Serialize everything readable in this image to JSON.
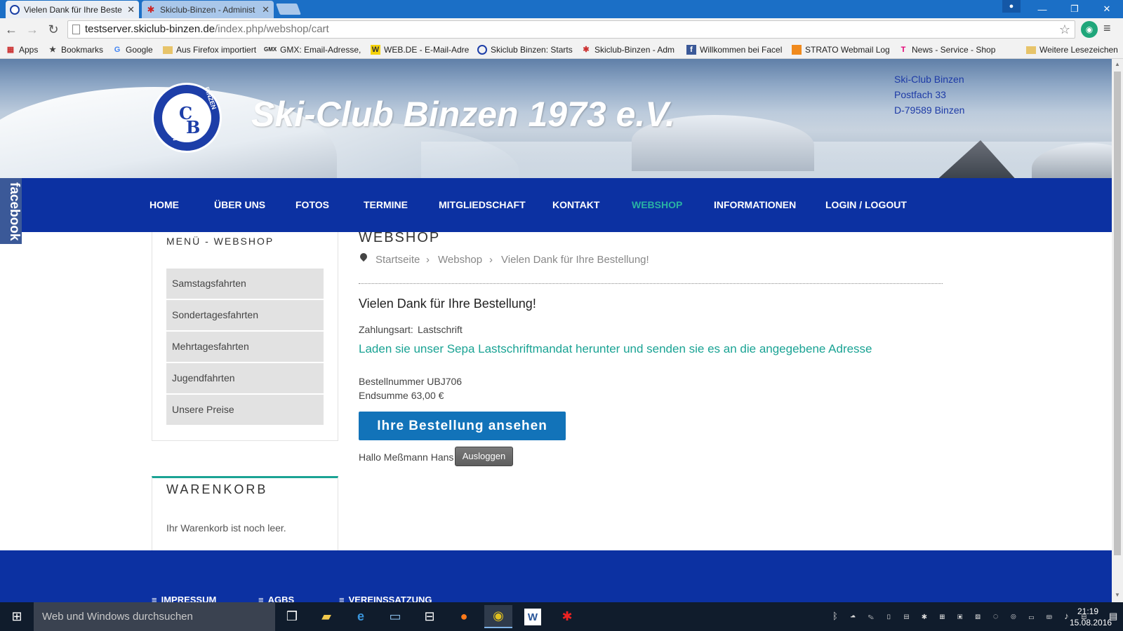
{
  "browser": {
    "tabs": [
      {
        "title": "Vielen Dank für Ihre Beste",
        "active": true
      },
      {
        "title": "Skiclub-Binzen - Administ",
        "active": false
      }
    ],
    "address": {
      "host": "testserver.skiclub-binzen.de",
      "path": "/index.php/webshop/cart"
    },
    "bookmarks": [
      {
        "label": "Apps",
        "icon": "apps-grid-icon"
      },
      {
        "label": "Bookmarks",
        "icon": "star-icon"
      },
      {
        "label": "Google",
        "icon": "google-icon"
      },
      {
        "label": "Aus Firefox importiert",
        "icon": "folder-icon"
      },
      {
        "label": "GMX: Email-Adresse, I",
        "icon": "gmx-icon"
      },
      {
        "label": "WEB.DE - E-Mail-Adre",
        "icon": "webde-icon"
      },
      {
        "label": "Skiclub Binzen: Starts",
        "icon": "skiclub-icon"
      },
      {
        "label": "Skiclub-Binzen - Adm",
        "icon": "joomla-icon"
      },
      {
        "label": "Willkommen bei Facel",
        "icon": "facebook-icon"
      },
      {
        "label": "STRATO Webmail Log",
        "icon": "strato-icon"
      },
      {
        "label": "News - Service - Shop",
        "icon": "telekom-icon"
      },
      {
        "label": "Weitere Lesezeichen",
        "icon": "folder-icon"
      }
    ]
  },
  "site": {
    "title": "Ski-Club Binzen 1973 e.V.",
    "logo_text": {
      "top": "BINZEN",
      "bottom": "1973 EV",
      "letters": [
        "C",
        "B"
      ]
    },
    "address_lines": [
      "Ski-Club Binzen",
      "Postfach 33",
      "D-79589 Binzen"
    ],
    "facebook_tab": "facebook",
    "nav": [
      {
        "label": "HOME",
        "active": false
      },
      {
        "label": "ÜBER UNS",
        "active": false
      },
      {
        "label": "FOTOS",
        "active": false
      },
      {
        "label": "TERMINE",
        "active": false
      },
      {
        "label": "MITGLIEDSCHAFT",
        "active": false
      },
      {
        "label": "KONTAKT",
        "active": false
      },
      {
        "label": "WEBSHOP",
        "active": true
      },
      {
        "label": "INFORMATIONEN",
        "active": false
      },
      {
        "label": "LOGIN / LOGOUT",
        "active": false
      }
    ]
  },
  "sidebar": {
    "heading": "MENÜ - WEBSHOP",
    "items": [
      "Samstagsfahrten",
      "Sondertagesfahrten",
      "Mehrtagesfahrten",
      "Jugendfahrten",
      "Unsere Preise"
    ],
    "cart": {
      "heading": "WARENKORB",
      "empty_text": "Ihr Warenkorb ist noch leer."
    }
  },
  "main": {
    "heading": "WEBSHOP",
    "breadcrumb": [
      "Startseite",
      "Webshop",
      "Vielen Dank für Ihre Bestellung!"
    ],
    "thanks": "Vielen Dank für Ihre Bestellung!",
    "payment_label": "Zahlungsart:",
    "payment_value": "Lastschrift",
    "sepa_link": "Laden sie unser Sepa Lastschriftmandat herunter und senden sie es an die angegebene Adresse",
    "order_number": "Bestellnummer UBJ706",
    "order_total": "Endsumme 63,00 €",
    "view_order_button": "Ihre Bestellung ansehen",
    "hello": "Hallo Meßmann Hans",
    "logout_button": "Ausloggen"
  },
  "footer": {
    "links": [
      "IMPRESSUM",
      "AGBS",
      "VEREINSSATZUNG"
    ]
  },
  "taskbar": {
    "search_placeholder": "Web und Windows durchsuchen",
    "apps": [
      "task-view-icon",
      "file-explorer-icon",
      "edge-icon",
      "remote-desktop-icon",
      "store-icon",
      "firefox-icon",
      "chrome-icon",
      "word-icon",
      "app-red-icon"
    ],
    "time": "21:19",
    "date": "15.08.2016"
  },
  "colors": {
    "nav_blue": "#0c31a2",
    "accent_teal": "#1aa394",
    "button_blue": "#1273b9"
  }
}
